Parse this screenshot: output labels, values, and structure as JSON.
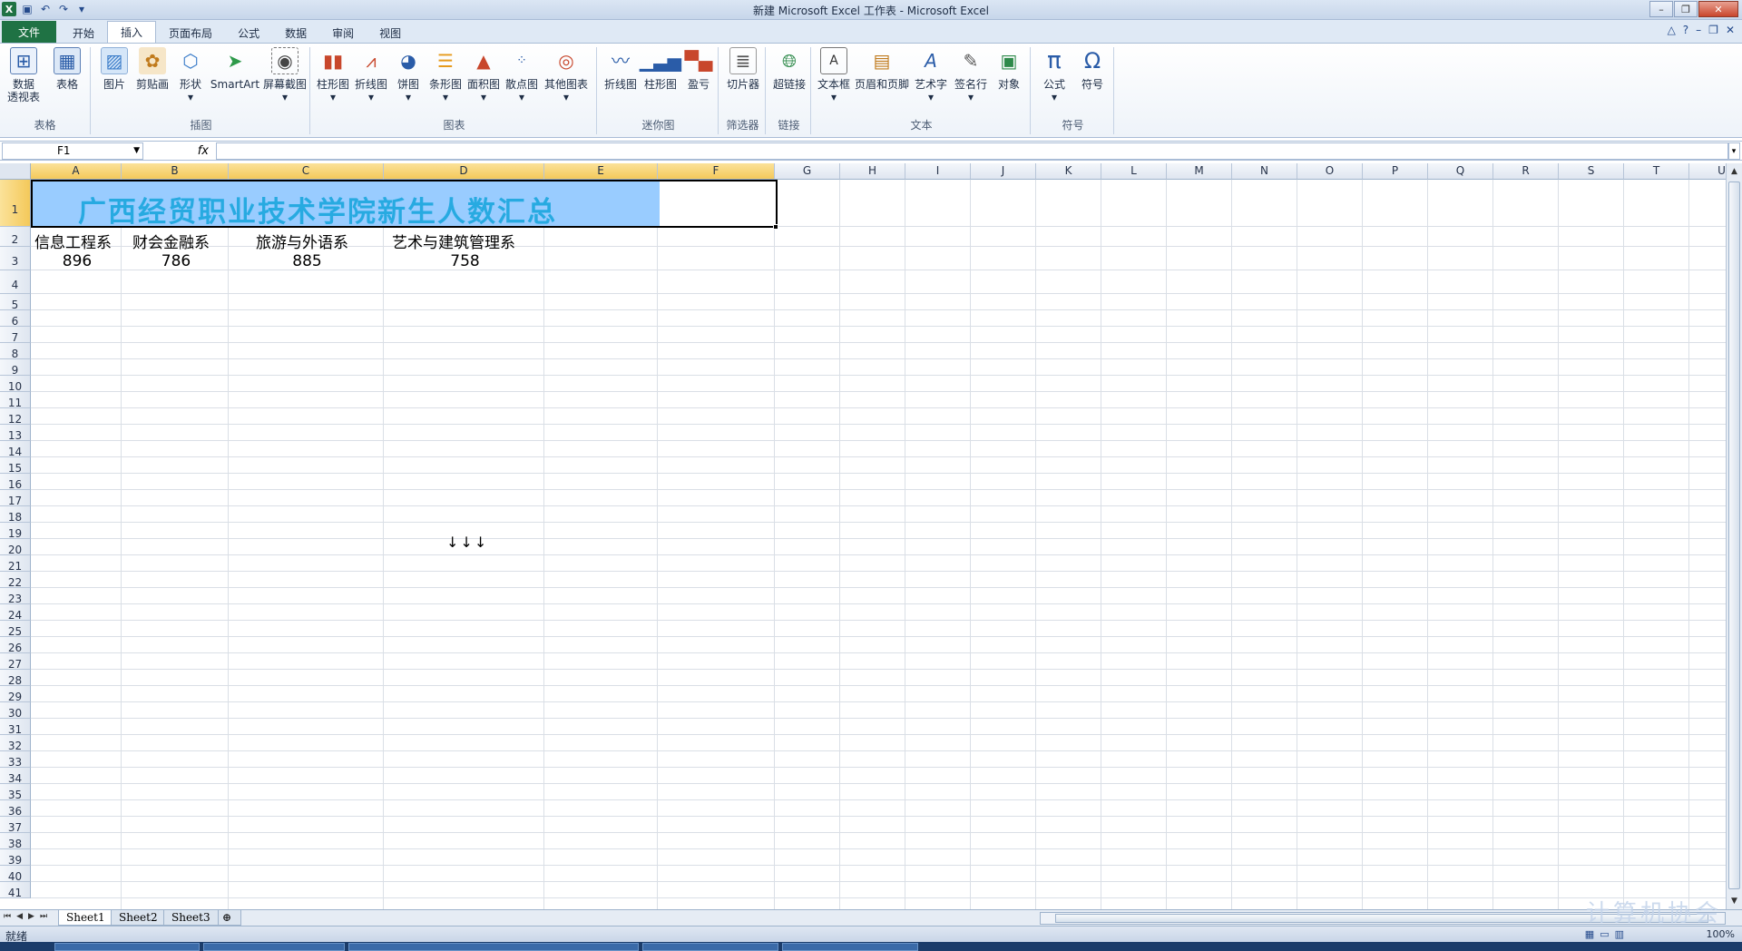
{
  "window": {
    "title": "新建 Microsoft Excel 工作表 - Microsoft Excel"
  },
  "tabs": [
    {
      "label": "文件",
      "key": "file"
    },
    {
      "label": "开始",
      "key": "home"
    },
    {
      "label": "插入",
      "key": "insert"
    },
    {
      "label": "页面布局",
      "key": "layout"
    },
    {
      "label": "公式",
      "key": "formulas"
    },
    {
      "label": "数据",
      "key": "data"
    },
    {
      "label": "审阅",
      "key": "review"
    },
    {
      "label": "视图",
      "key": "view"
    }
  ],
  "ribbon": {
    "groups": {
      "tables": "表格",
      "illustrations": "插图",
      "charts": "图表",
      "sparklines": "迷你图",
      "filter": "筛选器",
      "links": "链接",
      "text": "文本",
      "symbols": "符号"
    },
    "buttons": {
      "pivot": "数据",
      "pivot2": "透视表",
      "table": "表格",
      "picture": "图片",
      "clipart": "剪贴画",
      "shapes": "形状",
      "smartart": "SmartArt",
      "screenshot": "屏幕截图",
      "column": "柱形图",
      "line": "折线图",
      "pie": "饼图",
      "bar": "条形图",
      "area": "面积图",
      "scatter": "散点图",
      "other": "其他图表",
      "sp_line": "折线图",
      "sp_column": "柱形图",
      "sp_winloss": "盈亏",
      "slicer": "切片器",
      "hyperlink": "超链接",
      "textbox": "文本框",
      "headerfooter": "页眉和页脚",
      "wordart": "艺术字",
      "signature": "签名行",
      "object": "对象",
      "equation": "公式",
      "symbol": "符号"
    }
  },
  "formula_bar": {
    "name_box": "F1",
    "fx": "fx",
    "value": ""
  },
  "columns": [
    "A",
    "B",
    "C",
    "D",
    "E",
    "F",
    "G",
    "H",
    "I",
    "J",
    "K",
    "L",
    "M",
    "N",
    "O",
    "P",
    "Q",
    "R",
    "S",
    "T",
    "U"
  ],
  "rows": [
    "1",
    "2",
    "3",
    "4",
    "5",
    "6",
    "7",
    "8",
    "9",
    "10",
    "11",
    "12",
    "13",
    "14",
    "15",
    "16",
    "17",
    "18",
    "19",
    "20",
    "21",
    "22",
    "23",
    "24",
    "25",
    "26",
    "27",
    "28",
    "29",
    "30",
    "31",
    "32",
    "33",
    "34",
    "35",
    "36",
    "37",
    "38",
    "39",
    "40",
    "41"
  ],
  "sheet": {
    "title": "广西经贸职业技术学院新生人数汇总",
    "headers": [
      "信息工程系",
      "财会金融系",
      "旅游与外语系",
      "艺术与建筑管理系"
    ],
    "values": [
      "896",
      "786",
      "885",
      "758"
    ],
    "arrows": "↓↓↓"
  },
  "sheet_tabs": [
    "Sheet1",
    "Sheet2",
    "Sheet3"
  ],
  "status": {
    "ready": "就绪",
    "zoom": "100%"
  },
  "watermark": "计算机协会"
}
